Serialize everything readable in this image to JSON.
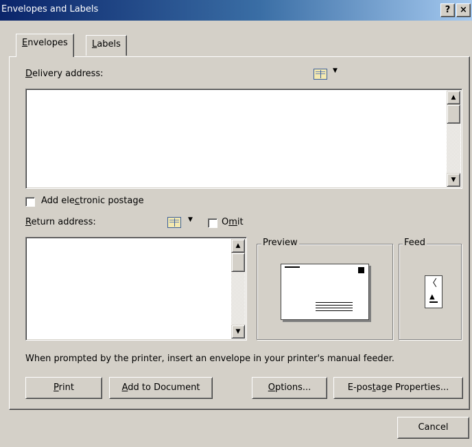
{
  "window": {
    "title": "Envelopes and Labels",
    "help_label": "?",
    "close_label": "×"
  },
  "tabs": [
    {
      "label": "Envelopes",
      "mnemonic": "E",
      "rest": "nvelopes",
      "active": true
    },
    {
      "label": "Labels",
      "mnemonic": "L",
      "rest": "abels",
      "active": false
    }
  ],
  "delivery": {
    "label_mnemonic": "D",
    "label_rest": "elivery address:",
    "value": "",
    "address_book_icon": "address-book-icon"
  },
  "postage": {
    "pre": "Add ele",
    "mnemonic": "c",
    "post": "tronic postage",
    "checked": false
  },
  "return": {
    "label_mnemonic": "R",
    "label_rest": "eturn address:",
    "value": "",
    "omit_pre": "O",
    "omit_mnemonic": "m",
    "omit_post": "it",
    "omit_checked": false
  },
  "preview": {
    "label": "Preview"
  },
  "feed": {
    "label": "Feed"
  },
  "instruction": "When prompted by the printer, insert an envelope in your printer's manual feeder.",
  "buttons": {
    "print_m": "P",
    "print_r": "rint",
    "add_m": "A",
    "add_r": "dd to Document",
    "options_m": "O",
    "options_r": "ptions...",
    "epost_pre": "E-pos",
    "epost_m": "t",
    "epost_post": "age Properties...",
    "cancel": "Cancel"
  },
  "colors": {
    "titlebar_start": "#0a246a",
    "titlebar_end": "#a6caf0",
    "face": "#d4d0c8"
  }
}
